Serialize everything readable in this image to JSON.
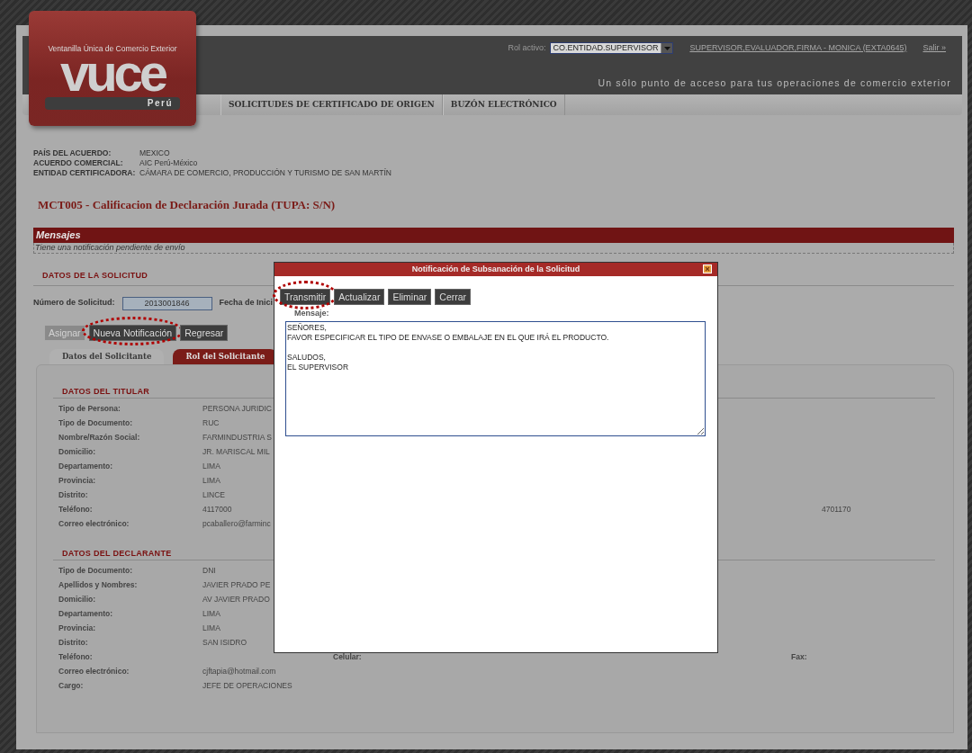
{
  "header": {
    "logo": {
      "subtitle": "Ventanilla Única de Comercio Exterior",
      "name": "vuce",
      "country": "Perú"
    },
    "role_label": "Rol activo:",
    "role_value": "CO.ENTIDAD.SUPERVISOR",
    "user_link": "SUPERVISOR,EVALUADOR,FIRMA - MONICA (EXTA0645)",
    "logout_link": "Salir »",
    "tagline": "Un sólo punto de acceso para tus operaciones de comercio exterior"
  },
  "nav": {
    "items": [
      "SOLICITUDES DE CERTIFICADO DE ORIGEN",
      "BUZÓN ELECTRÓNICO"
    ]
  },
  "agreement_info": [
    {
      "label": "PAÍS DEL ACUERDO:",
      "value": "MEXICO"
    },
    {
      "label": "ACUERDO COMERCIAL:",
      "value": "AIC Perú-México"
    },
    {
      "label": "ENTIDAD CERTIFICADORA:",
      "value": "CÁMARA DE COMERCIO, PRODUCCIÓN Y TURISMO DE SAN MARTÍN"
    }
  ],
  "page_title": "MCT005 - Calificacion de Declaración Jurada (TUPA: S/N)",
  "messages": {
    "title": "Mensajes",
    "text": "Tiene una notificación pendiente de envío"
  },
  "request": {
    "section_title": "DATOS DE LA SOLICITUD",
    "number_label": "Número de Solicitud:",
    "number_value": "2013001846",
    "date_label": "Fecha de Inici"
  },
  "buttons": [
    {
      "label": "Asignar",
      "disabled": true,
      "highlighted": false
    },
    {
      "label": "Nueva Notificación",
      "disabled": false,
      "highlighted": true
    },
    {
      "label": "Regresar",
      "disabled": false,
      "highlighted": false
    }
  ],
  "tabs": [
    {
      "label": "Datos del Solicitante",
      "selected": true
    },
    {
      "label": "Rol del Solicitante",
      "selected": false
    }
  ],
  "sections": [
    {
      "title": "DATOS DEL TITULAR",
      "rows": [
        {
          "label": "Tipo de Persona:",
          "value": "PERSONA JURIDIC"
        },
        {
          "label": "Tipo de Documento:",
          "value": "RUC"
        },
        {
          "label": "Nombre/Razón Social:",
          "value": "FARMINDUSTRIA S"
        },
        {
          "label": "Domicilio:",
          "value": "JR. MARISCAL MIL"
        },
        {
          "label": "Departamento:",
          "value": "LIMA"
        },
        {
          "label": "Provincia:",
          "value": "LIMA"
        },
        {
          "label": "Distrito:",
          "value": "LINCE"
        },
        {
          "label": "Teléfono:",
          "value": "4117000",
          "column_4_value": "4701170"
        },
        {
          "label": "Correo electrónico:",
          "value": "pcaballero@farminc"
        }
      ]
    },
    {
      "title": "DATOS DEL DECLARANTE",
      "rows": [
        {
          "label": "Tipo de Documento:",
          "value": "DNI"
        },
        {
          "label": "Apellidos y Nombres:",
          "value": "JAVIER PRADO PE"
        },
        {
          "label": "Domicilio:",
          "value": "AV JAVIER PRADO"
        },
        {
          "label": "Departamento:",
          "value": "LIMA"
        },
        {
          "label": "Provincia:",
          "value": "LIMA"
        },
        {
          "label": "Distrito:",
          "value": "SAN ISIDRO"
        },
        {
          "label": "Teléfono:",
          "column_3_label": "Celular:",
          "column_4_label": "Fax:"
        },
        {
          "label": "Correo electrónico:",
          "value": "cjftapia@hotmail.com"
        },
        {
          "label": "Cargo:",
          "value": "JEFE DE OPERACIONES"
        }
      ]
    }
  ],
  "modal": {
    "title": "Notificación de Subsanación de la Solicitud",
    "buttons": [
      {
        "label": "Transmitir",
        "highlighted": true
      },
      {
        "label": "Actualizar",
        "highlighted": false
      },
      {
        "label": "Eliminar",
        "highlighted": false
      },
      {
        "label": "Cerrar",
        "highlighted": false
      }
    ],
    "message_label": "Mensaje:",
    "message": "SEÑORES,\nFAVOR ESPECIFICAR EL TIPO DE ENVASE O EMBALAJE EN EL QUE IRÁ EL PRODUCTO.\n\nSALUDOS,\nEL SUPERVISOR"
  }
}
